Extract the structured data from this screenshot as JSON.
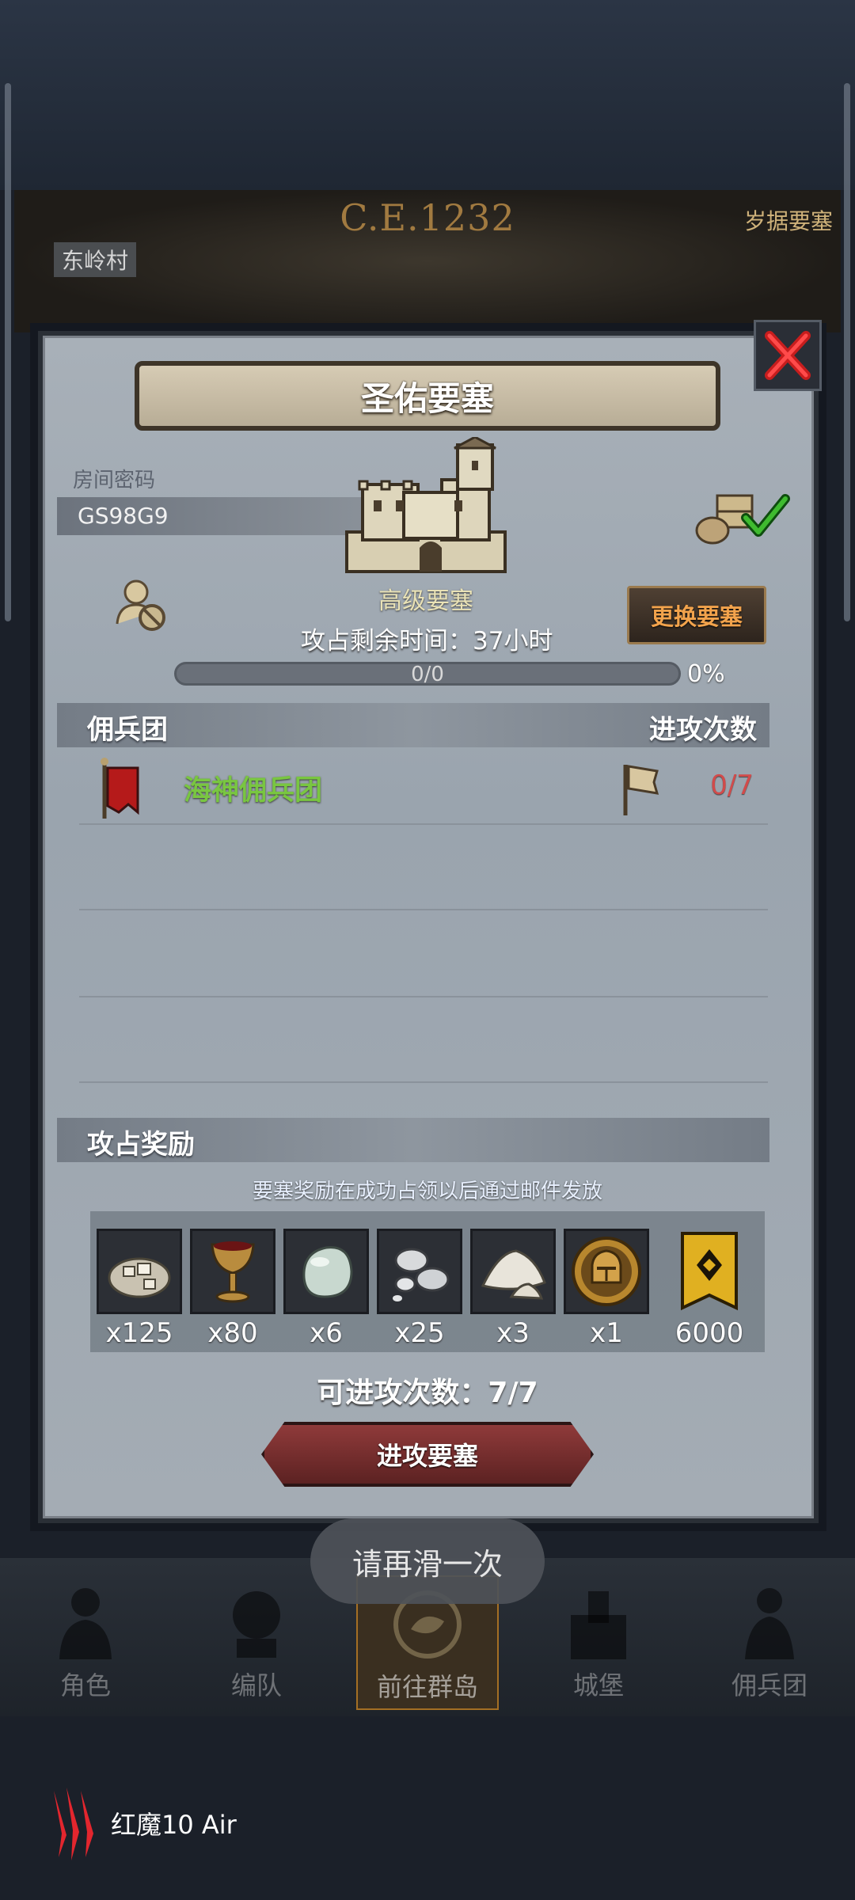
{
  "background": {
    "era_label": "C.E.1232",
    "left_label": "东岭村",
    "right_label": "岁据要塞"
  },
  "modal": {
    "title": "圣佑要塞",
    "room_code_label": "房间密码",
    "room_code": "GS98G9",
    "fortress_level": "高级要塞",
    "change_button": "更换要塞",
    "attack_time": "攻占剩余时间：37小时",
    "progress_text": "0/0",
    "progress_percent": "0%",
    "progress_value": 0,
    "mercenary_header": "佣兵团",
    "attacks_header": "进攻次数",
    "mercenary_name": "海神佣兵团",
    "mercenary_attacks": "0/7",
    "rewards_header": "攻占奖励",
    "rewards_note": "要塞奖励在成功占领以后通过邮件发放",
    "rewards": [
      {
        "icon": "stone-ore-icon",
        "qty": "x125"
      },
      {
        "icon": "goblet-icon",
        "qty": "x80"
      },
      {
        "icon": "jade-stone-icon",
        "qty": "x6"
      },
      {
        "icon": "silver-nuggets-icon",
        "qty": "x25"
      },
      {
        "icon": "salt-pile-icon",
        "qty": "x3"
      },
      {
        "icon": "knight-helmet-medal-icon",
        "qty": "x1"
      },
      {
        "icon": "guild-banner-icon",
        "qty": "6000"
      }
    ],
    "attacks_remaining": "可进攻次数：7/7",
    "attack_button": "进攻要塞"
  },
  "toast": "请再滑一次",
  "nav": {
    "items": [
      {
        "label": "角色",
        "icon": "character-icon"
      },
      {
        "label": "编队",
        "icon": "formation-icon"
      },
      {
        "label": "前往群岛",
        "icon": "islands-icon"
      },
      {
        "label": "城堡",
        "icon": "castle-icon"
      },
      {
        "label": "佣兵团",
        "icon": "mercenary-icon"
      }
    ],
    "active_index": 2
  },
  "device": {
    "name": "红魔10 Air"
  },
  "colors": {
    "mercenary_name": "#79c641",
    "attack_count": "#d24b4b",
    "change_button_text": "#f2a34c",
    "attack_button": "#7a2e2e"
  }
}
